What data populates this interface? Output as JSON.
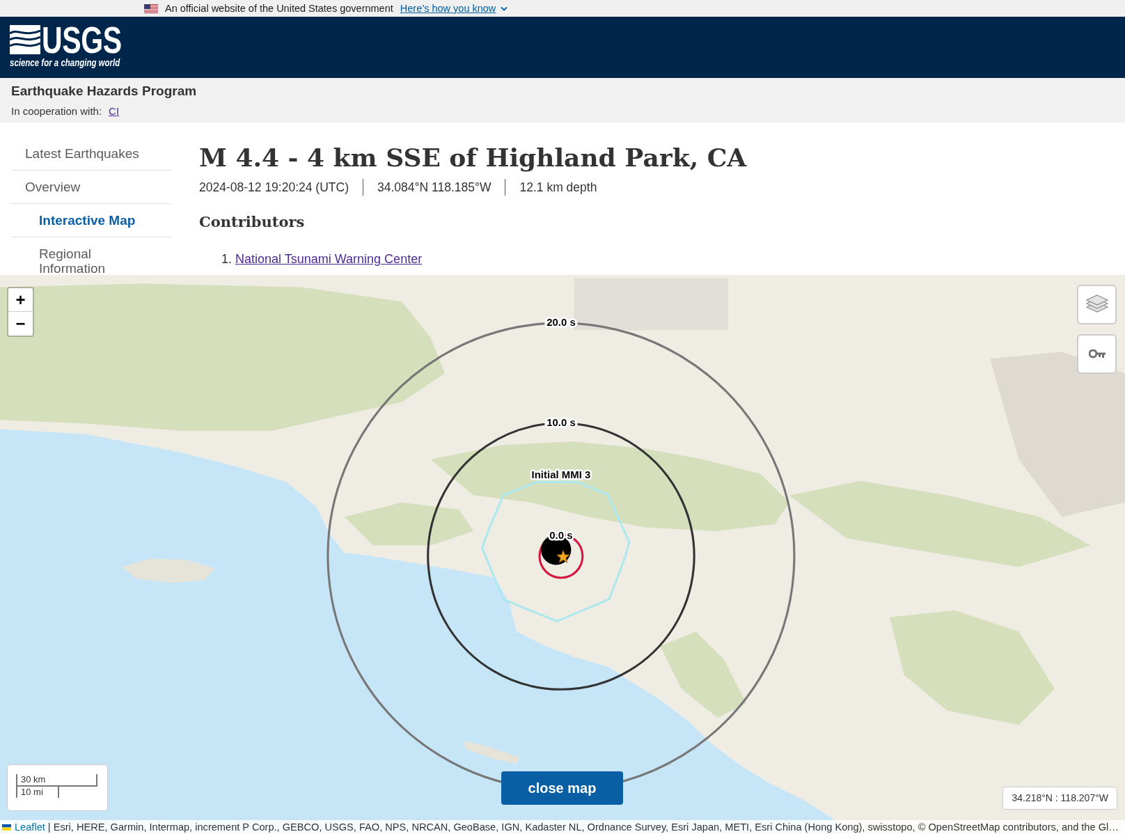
{
  "gov_banner": {
    "text": "An official website of the United States government",
    "link": "Here’s how you know"
  },
  "header": {
    "logo_wordmark": "USGS",
    "logo_tagline": "science for a changing world"
  },
  "program_bar": {
    "title": "Earthquake Hazards Program",
    "cooperation_label": "In cooperation with:",
    "cooperation_link": "CI"
  },
  "sidebar": {
    "items": [
      {
        "label": "Latest Earthquakes",
        "selected": false
      },
      {
        "label": "Overview",
        "selected": false,
        "children": [
          {
            "label": "Interactive Map",
            "selected": true
          },
          {
            "label": "Regional Information",
            "selected": false
          }
        ]
      }
    ]
  },
  "event": {
    "title": "M 4.4 - 4 km SSE of Highland Park, CA",
    "details": [
      "2024-08-12 19:20:24 (UTC)",
      "34.084°N 118.185°W",
      "12.1 km depth"
    ]
  },
  "contributors": {
    "heading": "Contributors",
    "items": [
      {
        "number": "1.",
        "name": "National Tsunami Warning Center"
      }
    ]
  },
  "map": {
    "zoom_controls": [
      "+",
      "−"
    ],
    "rings": [
      {
        "label": "20.0 s",
        "color": "#777777"
      },
      {
        "label": "10.0 s",
        "color": "#333333"
      },
      {
        "label": "0.0 s",
        "color": "#d4163e"
      }
    ],
    "contour": {
      "label": "Initial MMI 3"
    },
    "scale": [
      "30 km",
      "10 mi"
    ],
    "close_button": "close map",
    "coordinates": "34.218°N : 118.207°W",
    "attribution": {
      "link": "Leaflet",
      "text": "| Esri, HERE, Garmin, Intermap, increment P Corp., GEBCO, USGS, FAO, NPS, NRCAN, GeoBase, IGN, Kadaster NL, Ordnance Survey, Esri Japan, METI, Esri China (Hong Kong), swisstopo, © OpenStreetMap contributors, and the Gl…"
    }
  }
}
